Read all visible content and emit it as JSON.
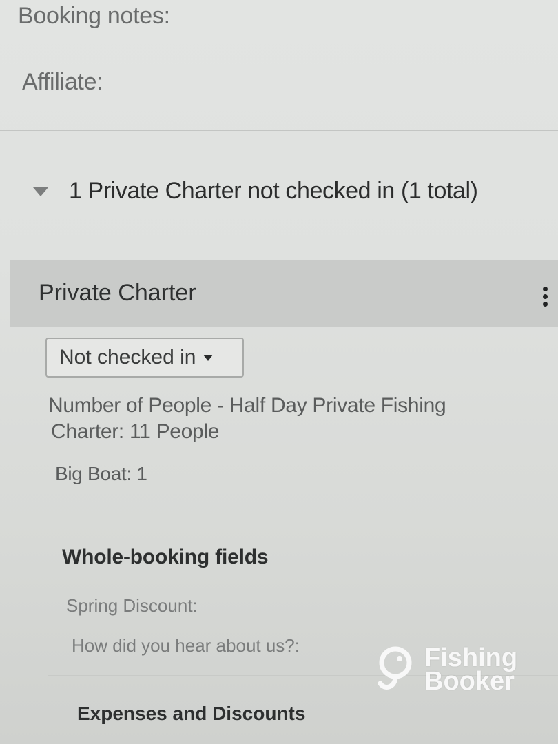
{
  "booking": {
    "notes_label": "Booking notes:",
    "affiliate_label": "Affiliate:"
  },
  "section": {
    "title": "1 Private Charter not checked in (1 total)",
    "icon": "triangle-down-icon"
  },
  "charter": {
    "title": "Private Charter",
    "menu_icon": "kebab-menu-icon",
    "status_dropdown": {
      "selected": "Not checked in"
    },
    "people_line_1": "Number of People - Half Day Private Fishing",
    "people_line_2": "Charter: 11 People",
    "big_boat": "Big Boat: 1"
  },
  "whole_booking": {
    "title": "Whole-booking fields",
    "spring_discount_label": "Spring Discount:",
    "hear_about_label": "How did you hear about us?:"
  },
  "expenses": {
    "title": "Expenses and Discounts"
  },
  "watermark": {
    "line1": "Fishing",
    "line2": "Booker"
  },
  "colors": {
    "background": "#dfe1df",
    "charter_header_bg": "#c9cbc9",
    "text_dark": "#2b2c2c",
    "text_muted": "#6a6c6c"
  }
}
